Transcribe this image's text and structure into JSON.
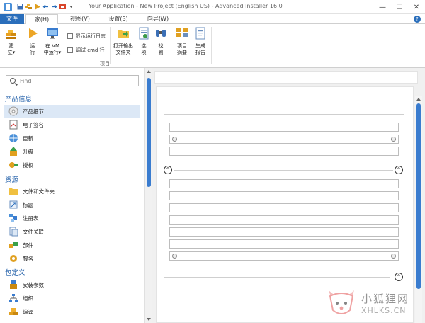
{
  "titlebar": {
    "title": "| Your Application - New Project (English US) - Advanced Installer 16.0",
    "app_icon": "advanced-installer-icon",
    "minimize": "—",
    "maximize": "☐",
    "close": "✕"
  },
  "tabs": {
    "file": "文件",
    "home": "家(H)",
    "view": "视图(V)",
    "settings": "设置(S)",
    "wizard": "向导(W)",
    "help": "?"
  },
  "ribbon": {
    "build_label": "建\n立▾",
    "run_label": "运\n行",
    "run_in_vm_label": "在 VM\n中运行▾",
    "show_log_label": "显示运行日志",
    "debug_cmd_label": "调试 cmd 行",
    "open_output_label": "打开输出\n文件夹",
    "options_label": "选\n项",
    "find_label": "找\n到",
    "summary_label": "项目\n摘要",
    "report_label": "生成\n报告",
    "group_label": "项目"
  },
  "sidebar": {
    "search_placeholder": "Find",
    "categories": [
      {
        "title": "产品信息",
        "items": [
          {
            "label": "产品细节",
            "icon": "product-details-icon",
            "selected": true
          },
          {
            "label": "电子签名",
            "icon": "digital-signature-icon"
          },
          {
            "label": "更新",
            "icon": "update-globe-icon"
          },
          {
            "label": "升级",
            "icon": "upgrade-icon"
          },
          {
            "label": "授权",
            "icon": "license-icon"
          }
        ]
      },
      {
        "title": "资源",
        "items": [
          {
            "label": "文件和文件夹",
            "icon": "folder-icon"
          },
          {
            "label": "标题",
            "icon": "shortcut-icon"
          },
          {
            "label": "注册表",
            "icon": "registry-icon"
          },
          {
            "label": "文件关联",
            "icon": "file-association-icon"
          },
          {
            "label": "部件",
            "icon": "component-icon"
          },
          {
            "label": "服务",
            "icon": "service-icon"
          }
        ]
      },
      {
        "title": "包定义",
        "items": [
          {
            "label": "安装参数",
            "icon": "install-parameters-icon"
          },
          {
            "label": "组织",
            "icon": "organization-icon"
          },
          {
            "label": "编译",
            "icon": "build-icon"
          }
        ]
      }
    ]
  },
  "watermark": {
    "cn": "小狐狸网",
    "en": "XHLKS.CN"
  },
  "colors": {
    "accent": "#2a6ebb",
    "category_text": "#1a5aa6",
    "selected_bg": "#dce8f6",
    "scroll_thumb": "#3a7ccf"
  }
}
